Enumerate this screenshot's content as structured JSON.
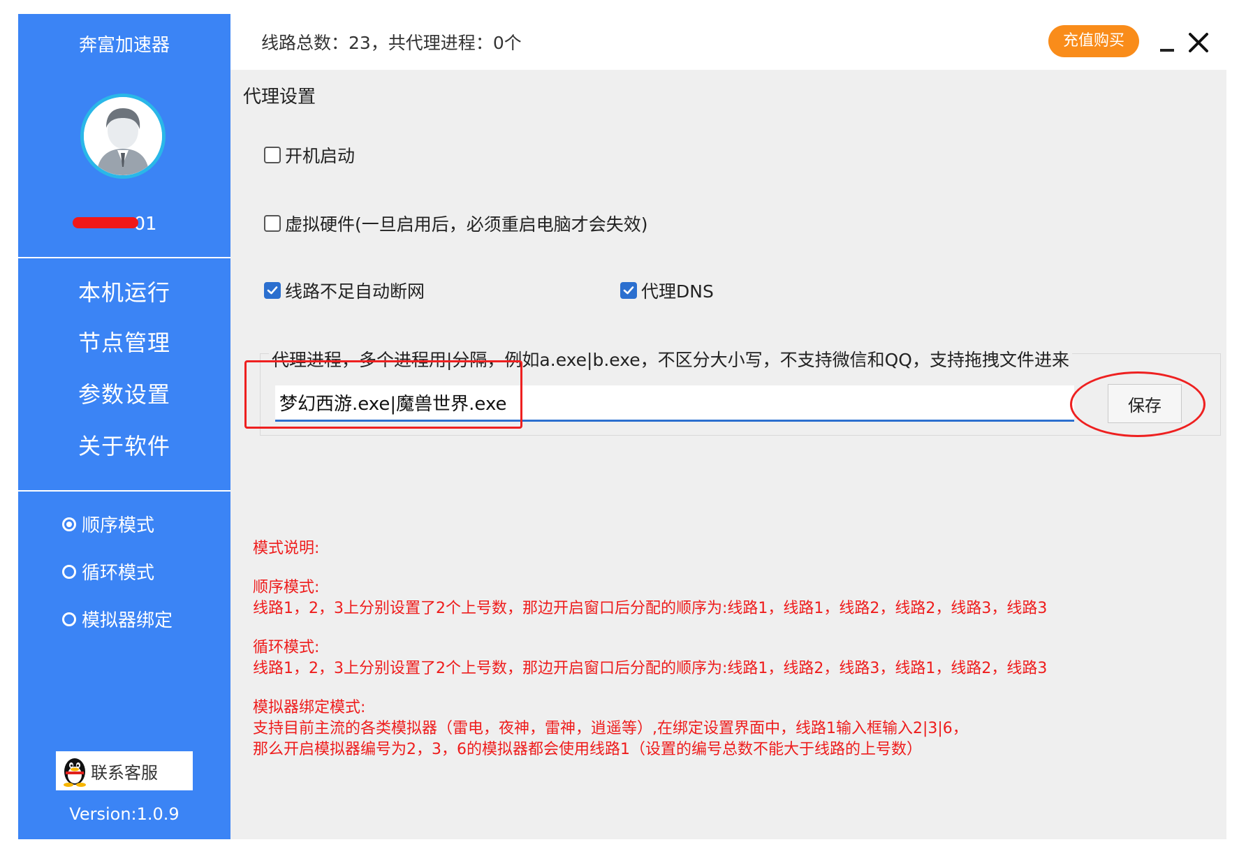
{
  "sidebar": {
    "app_title": "奔富加速器",
    "username": "01",
    "nav": [
      "本机运行",
      "节点管理",
      "参数设置",
      "关于软件"
    ],
    "modes": [
      {
        "label": "顺序模式",
        "selected": true
      },
      {
        "label": "循环模式",
        "selected": false
      },
      {
        "label": "模拟器绑定",
        "selected": false
      }
    ],
    "contact_label": "联系客服",
    "version": "Version:1.0.9"
  },
  "titlebar": {
    "stats": "线路总数：23，共代理进程：0个",
    "recharge_label": "充值购买",
    "minimize_label": "_",
    "close_label": "✕"
  },
  "settings": {
    "title": "代理设置",
    "options": {
      "autostart": {
        "label": "开机启动",
        "checked": false
      },
      "virtual_hw": {
        "label": "虚拟硬件(一旦启用后，必须重启电脑才会失效)",
        "checked": false
      },
      "auto_disconnect": {
        "label": "线路不足自动断网",
        "checked": true
      },
      "proxy_dns": {
        "label": "代理DNS",
        "checked": true
      }
    },
    "process_hint": "代理进程，多个进程用|分隔，例如a.exe|b.exe，不区分大小写，不支持微信和QQ，支持拖拽文件进来",
    "process_value": "梦幻西游.exe|魔兽世界.exe",
    "save_label": "保存"
  },
  "notes": {
    "heading": "模式说明:",
    "seq_title": "顺序模式:",
    "seq_desc": "线路1，2，3上分别设置了2个上号数，那边开启窗口后分配的顺序为:线路1，线路1，线路2，线路2，线路3，线路3",
    "loop_title": "循环模式:",
    "loop_desc": "线路1，2，3上分别设置了2个上号数，那边开启窗口后分配的顺序为:线路1，线路2，线路3，线路1，线路2，线路3",
    "emu_title": "模拟器绑定模式:",
    "emu_desc1": "支持目前主流的各类模拟器（雷电，夜神，雷神，逍遥等）,在绑定设置界面中，线路1输入框输入2|3|6，",
    "emu_desc2": "那么开启模拟器编号为2，3，6的模拟器都会使用线路1（设置的编号总数不能大于线路的上号数）"
  },
  "colors": {
    "sidebar_bg": "#3b84f5",
    "accent": "#2b6fcf",
    "recharge": "#f98c1a",
    "note_red": "#ee1c1c"
  }
}
